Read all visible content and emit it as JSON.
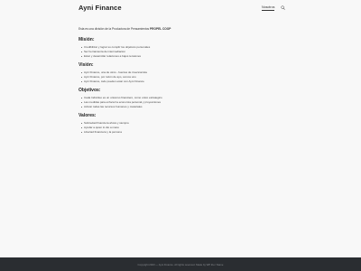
{
  "header": {
    "site_title": "Ayni Finance",
    "nav": {
      "item": "Nosotros"
    },
    "search_icon": "search-icon"
  },
  "intro": {
    "prefix": "Esta es una división de la Productora de Pensamientos ",
    "brand": "PROPEL COOP"
  },
  "sections": [
    {
      "title": "Misión:",
      "items": [
        "Credibilizar y lograr su cumplir los objetivos personales",
        "Ser herramienta de intermediacion",
        "Estar y desarrollar relaciones a bajos tensiones"
      ]
    },
    {
      "title": "Visión:",
      "items": [
        "Ayni Finance, una de otros - fuentes de inversionista",
        "Ayni Finance, por razón de ayo, somos uno",
        "Ayni Finance, todo pueden estar con Ayni Finance"
      ]
    },
    {
      "title": "Objetivos:",
      "items": [
        "Cada Individuo es un universo financiero, como unico estrategico",
        "Las medidas para enfocar la economía personal y proyecciones",
        "Activar todas las recursos humanos y materiales"
      ]
    },
    {
      "title": "Valores:",
      "items": [
        "Sobriedad financiera ahora y siempre",
        "Ayudar a quien lo dio a mano",
        "Libertad financiera y la persona"
      ]
    }
  ],
  "footer": {
    "text": "Copyright 2023 — Ayni Finance. All rights reserved. Made by WP the l Name"
  },
  "colors": {
    "background": "#f8f8f8",
    "footer_background": "#2a2d31",
    "title": "#222222"
  }
}
